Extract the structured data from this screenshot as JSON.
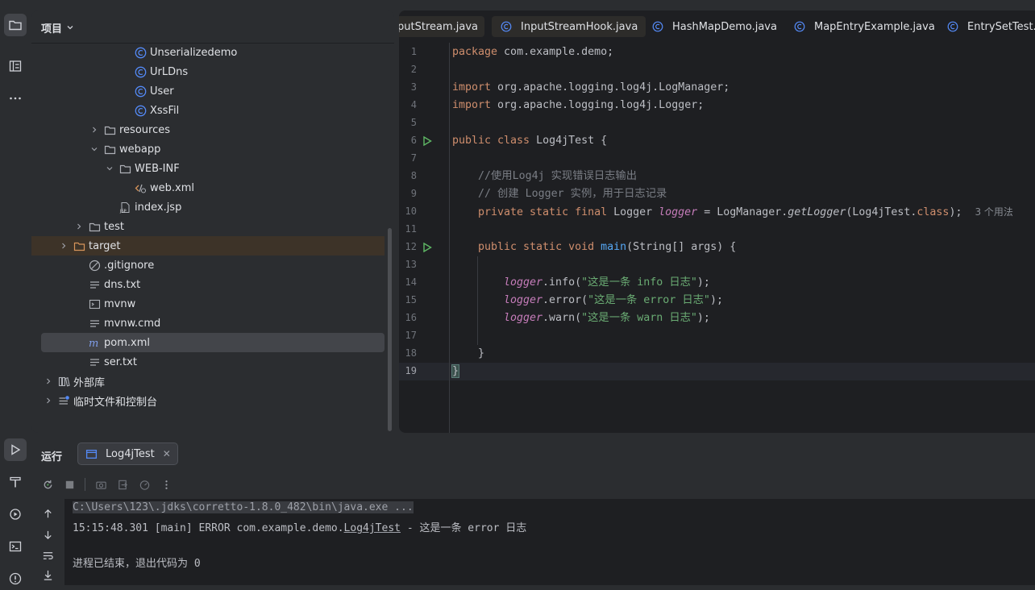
{
  "project": {
    "title": "项目",
    "tree": [
      {
        "label": "Unserializedemo",
        "icon": "java-class-icon",
        "indent": 5
      },
      {
        "label": "UrLDns",
        "icon": "java-class-icon",
        "indent": 5
      },
      {
        "label": "User",
        "icon": "java-class-icon",
        "indent": 5
      },
      {
        "label": "XssFil",
        "icon": "java-class-icon",
        "indent": 5
      },
      {
        "label": "resources",
        "icon": "folder-icon",
        "indent": 3,
        "chevron": "right"
      },
      {
        "label": "webapp",
        "icon": "folder-icon",
        "indent": 3,
        "chevron": "down"
      },
      {
        "label": "WEB-INF",
        "icon": "folder-icon",
        "indent": 4,
        "chevron": "down"
      },
      {
        "label": "web.xml",
        "icon": "xml-file-icon",
        "indent": 5
      },
      {
        "label": "index.jsp",
        "icon": "jsp-file-icon",
        "indent": 4
      },
      {
        "label": "test",
        "icon": "folder-icon",
        "indent": 2,
        "chevron": "right"
      },
      {
        "label": "target",
        "icon": "folder-orange-icon",
        "indent": 1,
        "chevron": "right"
      },
      {
        "label": ".gitignore",
        "icon": "gitignore-icon",
        "indent": 2
      },
      {
        "label": "dns.txt",
        "icon": "text-file-icon",
        "indent": 2
      },
      {
        "label": "mvnw",
        "icon": "terminal-file-icon",
        "indent": 2
      },
      {
        "label": "mvnw.cmd",
        "icon": "text-file-icon",
        "indent": 2
      },
      {
        "label": "pom.xml",
        "icon": "maven-icon",
        "indent": 2
      },
      {
        "label": "ser.txt",
        "icon": "text-file-icon",
        "indent": 2
      },
      {
        "label": "外部库",
        "icon": "library-icon",
        "indent": 0,
        "chevron": "right"
      },
      {
        "label": "临时文件和控制台",
        "icon": "scratches-icon",
        "indent": 0,
        "chevron": "right"
      }
    ]
  },
  "editor": {
    "tabs": [
      {
        "label": "putStream.java"
      },
      {
        "label": "InputStreamHook.java"
      },
      {
        "label": "HashMapDemo.java"
      },
      {
        "label": "MapEntryExample.java"
      },
      {
        "label": "EntrySetTest.java"
      }
    ],
    "line_numbers": [
      "1",
      "2",
      "3",
      "4",
      "5",
      "6",
      "7",
      "8",
      "9",
      "10",
      "11",
      "12",
      "13",
      "14",
      "15",
      "16",
      "17",
      "18",
      "19"
    ],
    "code": {
      "l1_kw": "package",
      "l1_rest": " com.example.demo;",
      "l3_kw": "import",
      "l3_rest": " org.apache.logging.log4j.LogManager;",
      "l4_kw": "import",
      "l4_rest": " org.apache.logging.log4j.Logger;",
      "l6_kw": "public class",
      "l6_name": " Log4jTest ",
      "l6_brace": "{",
      "l8_cmt": "//使用Log4j 实现错误日志输出",
      "l9_cmt": "// 创建 Logger 实例，用于日志记录",
      "l10_kw": "private static final",
      "l10_type": " Logger ",
      "l10_field": "logger",
      "l10_mid": " = LogManager.",
      "l10_call": "getLogger",
      "l10_arg": "(Log4jTest.",
      "l10_cls": "class",
      "l10_end": ");",
      "l10_hint": "3 个用法",
      "l12_kw": "public static void",
      "l12_sp": " ",
      "l12_fn": "main",
      "l12_rest": "(String[] args) {",
      "l14_field": "logger",
      "l14_mid": ".info(",
      "l14_str": "\"这是一条 info 日志\"",
      "l14_end": ");",
      "l15_field": "logger",
      "l15_mid": ".error(",
      "l15_str": "\"这是一条 error 日志\"",
      "l15_end": ");",
      "l16_field": "logger",
      "l16_mid": ".warn(",
      "l16_str": "\"这是一条 warn 日志\"",
      "l16_end": ");",
      "l18": "}",
      "l19": "}"
    }
  },
  "run": {
    "title": "运行",
    "tab_label": "Log4jTest",
    "console": {
      "cmd": "C:\\Users\\123\\.jdks\\corretto-1.8.0_482\\bin\\java.exe ...",
      "log_prefix": "15:15:48.301 [main] ERROR com.example.demo.",
      "log_class": "Log4jTest",
      "log_suffix": " - 这是一条 error 日志",
      "exit": "进程已结束，退出代码为 0"
    }
  },
  "colors": {
    "background": "#2b2d30",
    "editor_bg": "#1e1f22",
    "keyword": "#cf8e6d",
    "string": "#6aab73",
    "field": "#c77dbb",
    "function": "#56a8f5",
    "comment": "#7a7e85",
    "run_green": "#5fb865"
  }
}
